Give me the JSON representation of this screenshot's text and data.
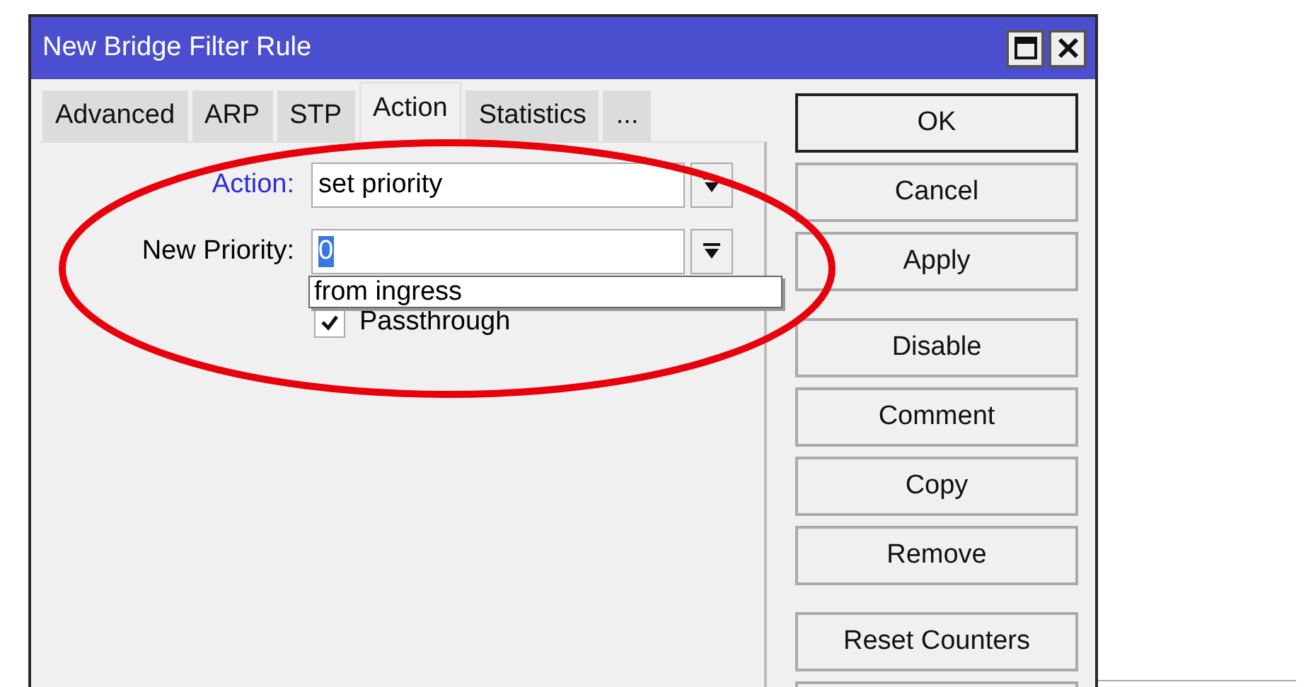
{
  "window": {
    "title": "New Bridge Filter Rule"
  },
  "tabs": [
    {
      "label": "Advanced",
      "selected": false
    },
    {
      "label": "ARP",
      "selected": false
    },
    {
      "label": "STP",
      "selected": false
    },
    {
      "label": "Action",
      "selected": true
    },
    {
      "label": "Statistics",
      "selected": false
    },
    {
      "label": "...",
      "selected": false
    }
  ],
  "fields": [
    {
      "label": "Action:",
      "color": "#2b2bd9",
      "value": "set priority",
      "value_selected": false
    },
    {
      "label": "New Priority:",
      "color": "#000000",
      "value": "0",
      "value_selected": true
    }
  ],
  "dropdown": {
    "options": [
      "from ingress"
    ]
  },
  "checkbox": {
    "label": "Passthrough",
    "checked": true
  },
  "button_groups": [
    [
      {
        "label": "OK",
        "default": true
      },
      {
        "label": "Cancel",
        "default": false
      },
      {
        "label": "Apply",
        "default": false
      }
    ],
    [
      {
        "label": "Disable",
        "default": false
      },
      {
        "label": "Comment",
        "default": false
      },
      {
        "label": "Copy",
        "default": false
      },
      {
        "label": "Remove",
        "default": false
      }
    ],
    [
      {
        "label": "Reset Counters",
        "default": false
      }
    ]
  ]
}
